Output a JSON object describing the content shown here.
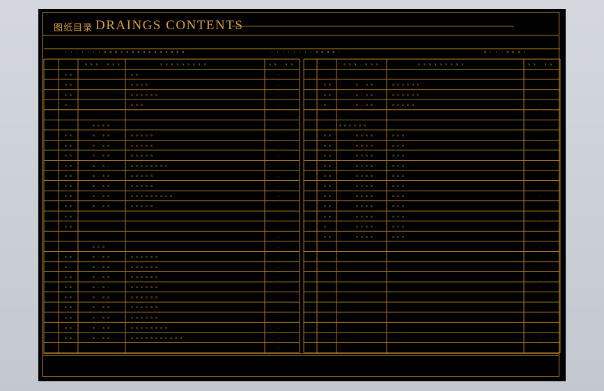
{
  "title": {
    "cn": "图纸目录",
    "en": "DRAINGS  CONTENTS"
  },
  "header_row": {
    "left_project": ": : : : : : : a a b c a   a a a a a a a a a a",
    "mid": ": : : : : : : : a a a a :",
    "right": "a : : : a a a :"
  },
  "columns": {
    "no": "",
    "drawing_no": "a a a . a a a",
    "description": "a a a a a a a a a",
    "size": "a a . a a"
  },
  "left_rows": [
    {
      "no": "",
      "code": "",
      "desc": "",
      "size": ""
    },
    {
      "no": "a a",
      "code": "",
      "desc": "a a",
      "size": "."
    },
    {
      "no": "a a",
      "code": "",
      "desc": "a a a a",
      "size": "."
    },
    {
      "no": "a a",
      "code": "",
      "desc": "a a a a a a",
      "size": "."
    },
    {
      "no": "a .",
      "code": "",
      "desc": "a a a",
      "size": "."
    },
    {
      "no": "",
      "code": "",
      "desc": "",
      "size": "."
    },
    {
      "no": "",
      "code": "a a a a",
      "desc": "",
      "size": "."
    },
    {
      "no": "a a",
      "code": "a . a a",
      "desc": "a a a a a",
      "size": "."
    },
    {
      "no": "a a",
      "code": "a . a a",
      "desc": "a a a a a",
      "size": "."
    },
    {
      "no": "a a",
      "code": "a . a a",
      "desc": "a a a a a",
      "size": "."
    },
    {
      "no": "a a",
      "code": "a . a .",
      "desc": "a a a a a a a a",
      "size": "."
    },
    {
      "no": "a a",
      "code": "a . a a",
      "desc": "a a a a a",
      "size": "."
    },
    {
      "no": "a a",
      "code": "a . a a",
      "desc": "a a a a a",
      "size": "."
    },
    {
      "no": "a a",
      "code": "a . a a",
      "desc": "a a a a a a a a a",
      "size": "."
    },
    {
      "no": "a a",
      "code": "a . a a",
      "desc": "a a a a a",
      "size": "."
    },
    {
      "no": "a a",
      "code": "",
      "desc": "",
      "size": "."
    },
    {
      "no": "a a",
      "code": "",
      "desc": "",
      "size": "."
    },
    {
      "no": "",
      "code": "",
      "desc": "",
      "size": "."
    },
    {
      "no": "",
      "code": "a a a",
      "desc": "",
      "size": "."
    },
    {
      "no": "a a",
      "code": "a . a a",
      "desc": "a a a a a a",
      "size": "."
    },
    {
      "no": "a .",
      "code": "a . a a",
      "desc": "a a a a a a",
      "size": "."
    },
    {
      "no": "a a",
      "code": "a . a a",
      "desc": "a a a a a a",
      "size": "."
    },
    {
      "no": "a a",
      "code": "a . a .",
      "desc": "a a a a a a",
      "size": "."
    },
    {
      "no": "a a",
      "code": "a . a a",
      "desc": "a a a a a a",
      "size": "."
    },
    {
      "no": "a a",
      "code": "a . a a",
      "desc": "a a a a a a",
      "size": "."
    },
    {
      "no": "a a",
      "code": "a . a a",
      "desc": "a a a a a a",
      "size": "."
    },
    {
      "no": "a a",
      "code": "a . a a",
      "desc": "a a a a a a a a",
      "size": "."
    },
    {
      "no": "a a",
      "code": "a . a a",
      "desc": "a a a a a a a a a a a",
      "size": "."
    },
    {
      "no": "",
      "code": "",
      "desc": "",
      "size": "."
    }
  ],
  "right_rows": [
    {
      "no": "",
      "code": "",
      "desc": "",
      "size": ""
    },
    {
      "no": "",
      "code": "",
      "desc": "",
      "size": "."
    },
    {
      "no": "a a",
      "code": "a . a a",
      "desc": "a a a a a a",
      "size": "."
    },
    {
      "no": "a a",
      "code": "a . a a",
      "desc": "a a a a a a",
      "size": "."
    },
    {
      "no": "a .",
      "code": "a . a a",
      "desc": "a a a a a",
      "size": "."
    },
    {
      "no": "",
      "code": "",
      "desc": "",
      "size": "."
    },
    {
      "no": "",
      "code": "a a a a a a",
      "desc": "",
      "size": "."
    },
    {
      "no": "a a",
      "code": "a a a a",
      "desc": "a a a",
      "size": "."
    },
    {
      "no": "a a",
      "code": "a a a a",
      "desc": "a a a",
      "size": "."
    },
    {
      "no": "a a",
      "code": "a a a a",
      "desc": "a a a",
      "size": "."
    },
    {
      "no": "a a",
      "code": "a a a a",
      "desc": "a a a",
      "size": "."
    },
    {
      "no": "a a",
      "code": "a a a a",
      "desc": "a a a",
      "size": "."
    },
    {
      "no": "a a",
      "code": "a a a a",
      "desc": "a a a",
      "size": "."
    },
    {
      "no": "a a",
      "code": "a a a a",
      "desc": "a a a",
      "size": "."
    },
    {
      "no": "a a",
      "code": "a a a a",
      "desc": "a a a",
      "size": "."
    },
    {
      "no": "a a",
      "code": "a a a a",
      "desc": "a a a",
      "size": "."
    },
    {
      "no": "a .",
      "code": "a a a a",
      "desc": "a a a",
      "size": "."
    },
    {
      "no": "a a",
      "code": "a a a a",
      "desc": "a a a",
      "size": "."
    },
    {
      "no": "",
      "code": "",
      "desc": "",
      "size": "."
    },
    {
      "no": "",
      "code": "",
      "desc": "",
      "size": "."
    },
    {
      "no": "",
      "code": "",
      "desc": "",
      "size": "."
    },
    {
      "no": "",
      "code": "",
      "desc": "",
      "size": "."
    },
    {
      "no": "",
      "code": "",
      "desc": "",
      "size": "."
    },
    {
      "no": "",
      "code": "",
      "desc": "",
      "size": "."
    },
    {
      "no": "",
      "code": "",
      "desc": "",
      "size": "."
    },
    {
      "no": "",
      "code": "",
      "desc": "",
      "size": "."
    },
    {
      "no": "",
      "code": "",
      "desc": "",
      "size": "."
    },
    {
      "no": "",
      "code": "",
      "desc": "",
      "size": "."
    },
    {
      "no": "",
      "code": "",
      "desc": "",
      "size": "."
    }
  ],
  "colors": {
    "line": "#b8862b",
    "text": "#d9a23a",
    "background": "#000000",
    "viewport": "#c9ced6"
  }
}
